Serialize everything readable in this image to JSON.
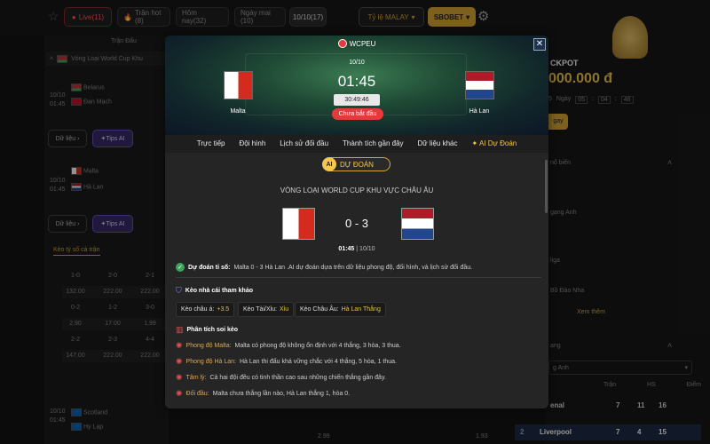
{
  "topbar": {
    "tabs": [
      "Live(11)",
      "Trận hot (8)",
      "Hôm nay(32)",
      "Ngày mai (10)",
      "10/10(17)"
    ],
    "odds_select": "Tỷ lệ MALAY",
    "bookmaker_select": "SBOBET"
  },
  "left": {
    "header": "Trận Đấu",
    "league": "Vòng Loại World Cup Khu",
    "matches": [
      {
        "date": "10/10",
        "time": "01:45",
        "home": "Belarus",
        "away": "Đan Mạch"
      },
      {
        "date": "10/10",
        "time": "01:45",
        "home": "Malta",
        "away": "Hà Lan"
      },
      {
        "date": "10/10",
        "time": "01:45",
        "home": "Scotland",
        "away": "Hy Lạp"
      }
    ],
    "data_btn": "Dữ liệu",
    "tips_btn": "Tips AI",
    "odds_title": "Kèo tỷ số cả trận",
    "odds_rows": [
      [
        "1-0",
        "2-0",
        "2-1"
      ],
      [
        "132.00",
        "222.00",
        "222.00"
      ],
      [
        "0-2",
        "1-2",
        "3-0"
      ],
      [
        "2.90",
        "17.00",
        "1.99"
      ],
      [
        "2-2",
        "2-3",
        "4-4"
      ],
      [
        "147.00",
        "222.00",
        "222.00"
      ]
    ],
    "bottom_odds": [
      "2.99",
      "1.93"
    ]
  },
  "right": {
    "jackpot_label": "CKPOT",
    "jackpot_value": "000.000 đ",
    "countdown": [
      "5",
      "Ngày",
      "05",
      ":",
      "04",
      ":",
      "46"
    ],
    "cta": "gay",
    "popular": "nổ biến",
    "links": [
      "gạng Anh",
      "liga",
      "Bồ Đào Nha"
    ],
    "see_more": "Xem thêm",
    "standings_title": "ạng",
    "league_select": "g Anh",
    "cols": [
      "Trận",
      "HS",
      "Điểm"
    ],
    "rows": [
      {
        "team": "enal",
        "p": "7",
        "hs": "11",
        "pts": "16"
      },
      {
        "rank": "2",
        "team": "Liverpool",
        "p": "7",
        "hs": "4",
        "pts": "15"
      }
    ]
  },
  "modal": {
    "brand": "WCPEU",
    "date": "10/10",
    "time": "01:45",
    "countdown": "30:49:46",
    "status": "Chưa bắt đầu",
    "home": "Malta",
    "away": "Hà Lan",
    "tabs": [
      "Trực tiếp",
      "Đội hình",
      "Lịch sử đối đầu",
      "Thành tích gần đây",
      "Dữ liệu khác",
      "AI Dự Đoán"
    ],
    "ai_badge": "DỰ ĐOÁN",
    "ai_circle": "AI",
    "competition": "VÒNG LOẠI WORLD CUP KHU VỰC CHÂU ÂU",
    "score": "0 - 3",
    "match_time": "01:45",
    "match_date": "10/10",
    "prediction_label": "Dự đoán tỉ số:",
    "prediction_text": "Malta 0 - 3 Hà Lan .AI dự đoán dựa trên dữ liệu phong độ, đối hình, và lịch sử đối đầu.",
    "ref_title": "Kèo nhà cái tham khảo",
    "chips": [
      {
        "label": "Kèo châu á:",
        "value": "+3.5"
      },
      {
        "label": "Kèo Tài/Xỉu:",
        "value": "Xỉu"
      },
      {
        "label": "Kèo Châu Âu:",
        "value": "Hà Lan Thắng"
      }
    ],
    "analysis_title": "Phân tích soi kèo",
    "analysis": [
      {
        "label": "Phong độ Malta:",
        "text": "Malta có phong độ không ổn định với 4 thắng, 3 hòa, 3 thua."
      },
      {
        "label": "Phong độ Hà Lan:",
        "text": "Hà Lan thi đấu khá vững chắc với 4 thắng, 5 hòa, 1 thua."
      },
      {
        "label": "Tâm lý:",
        "text": "Cả hai đội đều có tinh thần cao sau những chiến thắng gần đây."
      },
      {
        "label": "Đối đầu:",
        "text": "Malta chưa thắng lần nào, Hà Lan thắng 1, hòa 0."
      }
    ]
  }
}
